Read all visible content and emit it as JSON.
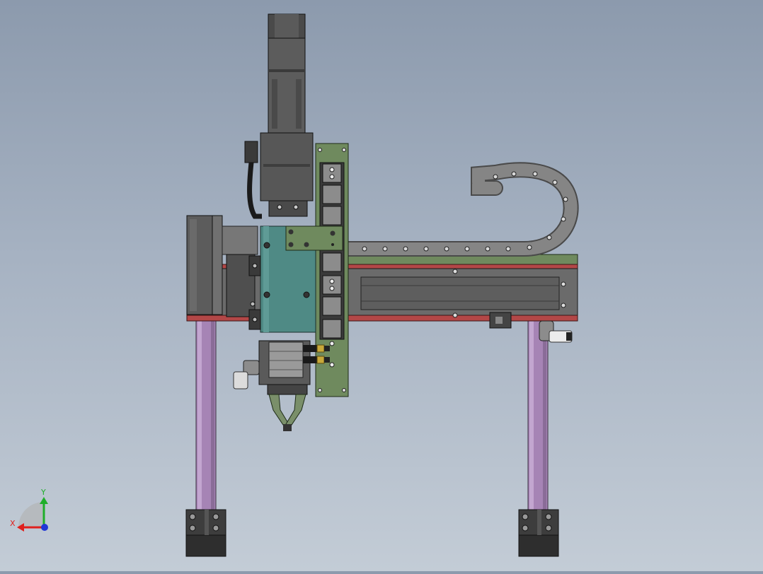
{
  "view": {
    "background_top": "#8c9aad",
    "background_bottom": "#c3ccd6"
  },
  "triad": {
    "x_label": "X",
    "y_label": "Y",
    "x_color": "#e0201c",
    "y_color": "#1fae2a",
    "z_color": "#2237d6"
  },
  "palette": {
    "motor": "#5c5c5c",
    "rail": "#6b6b6b",
    "top_rail": "#6f8a5e",
    "carriage": "#4f8a85",
    "mount_plate": "#6f8a5e",
    "legs": "#a684b5",
    "feet": "#3d3d3d",
    "drag_chain": "#7a7a7a",
    "gripper": "#7a8f6a",
    "red_strip": "#b34747",
    "fitting_brass": "#c8a83a"
  }
}
